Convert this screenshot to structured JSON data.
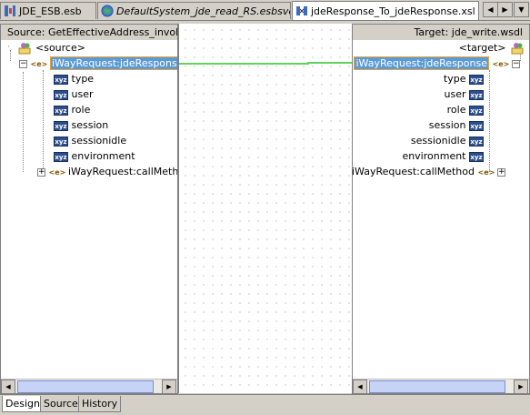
{
  "tabs": [
    {
      "label": "JDE_ESB.esb",
      "icon": "esb-file-icon",
      "italic": false
    },
    {
      "label": "DefaultSystem_jde_read_RS.esbsvc",
      "icon": "globe-icon",
      "italic": true
    },
    {
      "label": "jdeResponse_To_jdeResponse.xsl",
      "icon": "xsl-map-icon",
      "italic": false
    }
  ],
  "nav": {
    "left": "◀",
    "right": "▶",
    "list": "▼"
  },
  "source": {
    "header": "Source: GetEffectiveAddress_invoke.wsdl",
    "root": "<source>",
    "selected": "iWayRequest:jdeResponse",
    "attributes": [
      "type",
      "user",
      "role",
      "session",
      "sessionidle",
      "environment"
    ],
    "child": "iWayRequest:callMethod",
    "elem_glyph": "<e>",
    "xyz_glyph": "xyz"
  },
  "target": {
    "header": "Target: jde_write.wsdl",
    "root": "<target>",
    "selected": "iWayRequest:jdeResponse",
    "attributes": [
      "type",
      "user",
      "role",
      "session",
      "sessionidle",
      "environment"
    ],
    "child": "iWayRequest:callMethod"
  },
  "bottom_tabs": [
    "Design",
    "Source",
    "History"
  ],
  "colors": {
    "link_line": "#5fd35f",
    "selection": "#5b9bd5",
    "selection_border": "#f0a030"
  }
}
